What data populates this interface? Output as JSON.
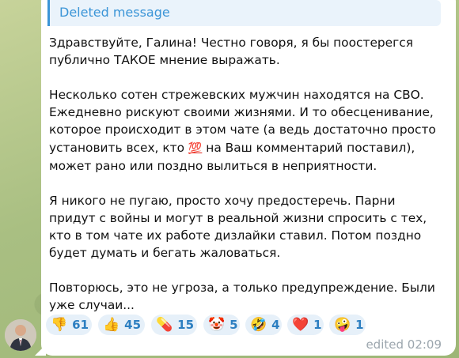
{
  "reply": {
    "label": "Deleted message"
  },
  "message": {
    "p1": "Здравствуйте, Галина! Честно говоря, я бы поостерегся публично ТАКОЕ мнение выражать.",
    "p2a": "Несколько сотен стрежевских мужчин находятся на СВО. Ежедневно рискуют своими жизнями. И то обесценивание, которое происходит в этом чате (а ведь достаточно просто установить всех, кто ",
    "p2_emoji": "💯",
    "p2b": " на Ваш комментарий поставил), может рано или поздно вылиться в неприятности.",
    "p3": "Я никого не пугаю, просто хочу предостеречь. Парни придут с войны и могут в реальной жизни спросить с тех, кто в том чате их работе дизлайки ставил. Потом поздно будет думать и бегать жаловаться.",
    "p4": "Повторюсь, это не угроза, а только предупреждение. Были уже случаи..."
  },
  "reactions": [
    {
      "emoji": "👎",
      "count": "61",
      "icon": "thumbs-down-icon"
    },
    {
      "emoji": "👍",
      "count": "45",
      "icon": "thumbs-up-icon"
    },
    {
      "emoji": "💊",
      "count": "15",
      "icon": "pill-icon"
    },
    {
      "emoji": "🤡",
      "count": "5",
      "icon": "clown-icon"
    },
    {
      "emoji": "🤣",
      "count": "4",
      "icon": "rofl-icon"
    },
    {
      "emoji": "❤️",
      "count": "1",
      "icon": "heart-icon"
    },
    {
      "emoji": "🤪",
      "count": "1",
      "icon": "zany-face-icon"
    }
  ],
  "meta": {
    "edited": "edited 02:09"
  },
  "colors": {
    "accent": "#3b95d7",
    "reaction_bg": "#e6f0f9",
    "reaction_text": "#2d7fc1",
    "chat_bg": "#b9c98f"
  }
}
